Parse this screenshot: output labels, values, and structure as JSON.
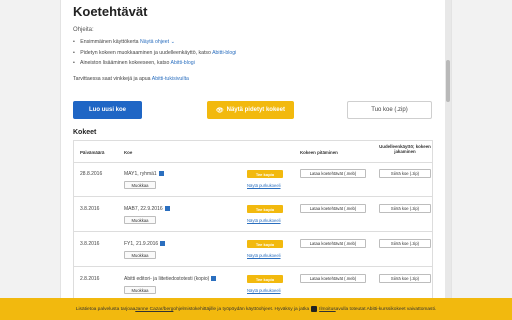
{
  "header": {
    "title": "Koetehtävät"
  },
  "help": {
    "heading": "Ohjeita:",
    "items": [
      {
        "text": "Ensimmäinen käyttökerta ",
        "link": "Näytä ohjeet"
      },
      {
        "text": "Pidetyn kokeen muokkaaminen ja uudelleenkäyttö, katso ",
        "link": "Abitti-blogi"
      },
      {
        "text": "Aineiston lisääminen kokeeseen, katso ",
        "link": "Abitti-blogi"
      }
    ],
    "support_text": "Tarvittaessa saat vinkkejä ja apua ",
    "support_link": "Abitti-tukisivuilta"
  },
  "actions": {
    "new_exam": "Luo uusi koe",
    "show_held": "Näytä pidetyt kokeet",
    "import": "Tuo koe (.zip)"
  },
  "exams": {
    "title": "Kokeet",
    "columns": {
      "date": "Päivämäärä",
      "exam": "Koe",
      "load": "Kokeen pitäminen",
      "reuse": "Uudelleenkäyttö; kokeen jakaminen"
    },
    "copy_label": "Muokkaa",
    "print_label": "Tee kopio",
    "answers_label": "Näytä purkukoeeli",
    "load_label": "Lataa koetehtävät (.meb)",
    "move_label": "Siirrä koe (.zip)",
    "rows": [
      {
        "date": "28.8.2016",
        "name": "MAY1, ryhmä1"
      },
      {
        "date": "3.8.2016",
        "name": "MAB7, 22.9.2016"
      },
      {
        "date": "3.8.2016",
        "name": "FY1, 21.9.2016"
      },
      {
        "date": "2.8.2016",
        "name": "Abitti editori- ja liitetiedostotesti (kopio)"
      }
    ]
  },
  "cookie_bar": {
    "text_before": "Lisätietoa palvelusta tarjoaa ",
    "link1": "Janne Cazar/berg",
    "text_middle": " ohjelmistokehittäjille ja työpöydän käyttöohjeet. Hyväksy ja jatka ",
    "link2": "Ilmoitus",
    "text_after": " avulla toteutat Abitti-kurssikokeet vaivattomasti."
  },
  "colors": {
    "primary": "#1f66c5",
    "accent": "#f2b90e",
    "link": "#2b6fbf"
  }
}
